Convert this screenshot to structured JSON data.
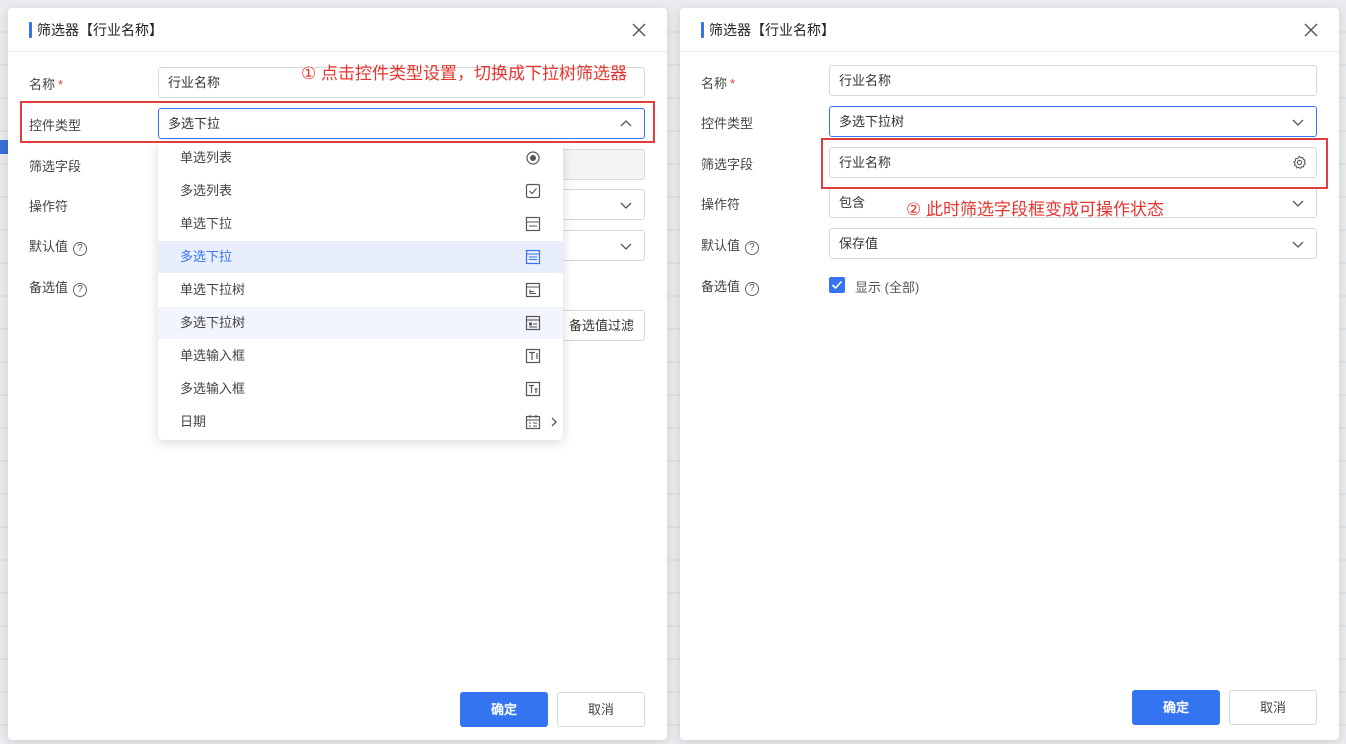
{
  "left_dialog": {
    "title": "筛选器【行业名称】",
    "labels": {
      "name": "名称",
      "required_mark": "*",
      "control_type": "控件类型",
      "filter_field": "筛选字段",
      "operator": "操作符",
      "default_value": "默认值",
      "candidate_value": "备选值"
    },
    "name_value": "行业名称",
    "control_type_value": "多选下拉",
    "candidate_filter_button": "备选值过滤",
    "dropdown_options": [
      {
        "label": "单选列表",
        "icon": "radio-icon"
      },
      {
        "label": "多选列表",
        "icon": "checkbox-icon"
      },
      {
        "label": "单选下拉",
        "icon": "dropdown-icon"
      },
      {
        "label": "多选下拉",
        "icon": "multi-dropdown-icon"
      },
      {
        "label": "单选下拉树",
        "icon": "tree-dropdown-icon"
      },
      {
        "label": "多选下拉树",
        "icon": "multi-tree-dropdown-icon"
      },
      {
        "label": "单选输入框",
        "icon": "text-input-icon"
      },
      {
        "label": "多选输入框",
        "icon": "multi-text-input-icon"
      },
      {
        "label": "日期",
        "icon": "calendar-icon"
      }
    ],
    "selected_option": "多选下拉",
    "confirm": "确定",
    "cancel": "取消",
    "annotation": "① 点击控件类型设置，切换成下拉树筛选器"
  },
  "right_dialog": {
    "title": "筛选器【行业名称】",
    "labels": {
      "name": "名称",
      "required_mark": "*",
      "control_type": "控件类型",
      "filter_field": "筛选字段",
      "operator": "操作符",
      "default_value": "默认值",
      "candidate_value": "备选值"
    },
    "name_value": "行业名称",
    "control_type_value": "多选下拉树",
    "filter_field_value": "行业名称",
    "operator_value": "包含",
    "default_value_value": "保存值",
    "show_checkbox_label": "显示 (全部)",
    "confirm": "确定",
    "cancel": "取消",
    "annotation": "② 此时筛选字段框变成可操作状态"
  },
  "colors": {
    "accent": "#3574f0",
    "annotation": "#e23c3c"
  }
}
